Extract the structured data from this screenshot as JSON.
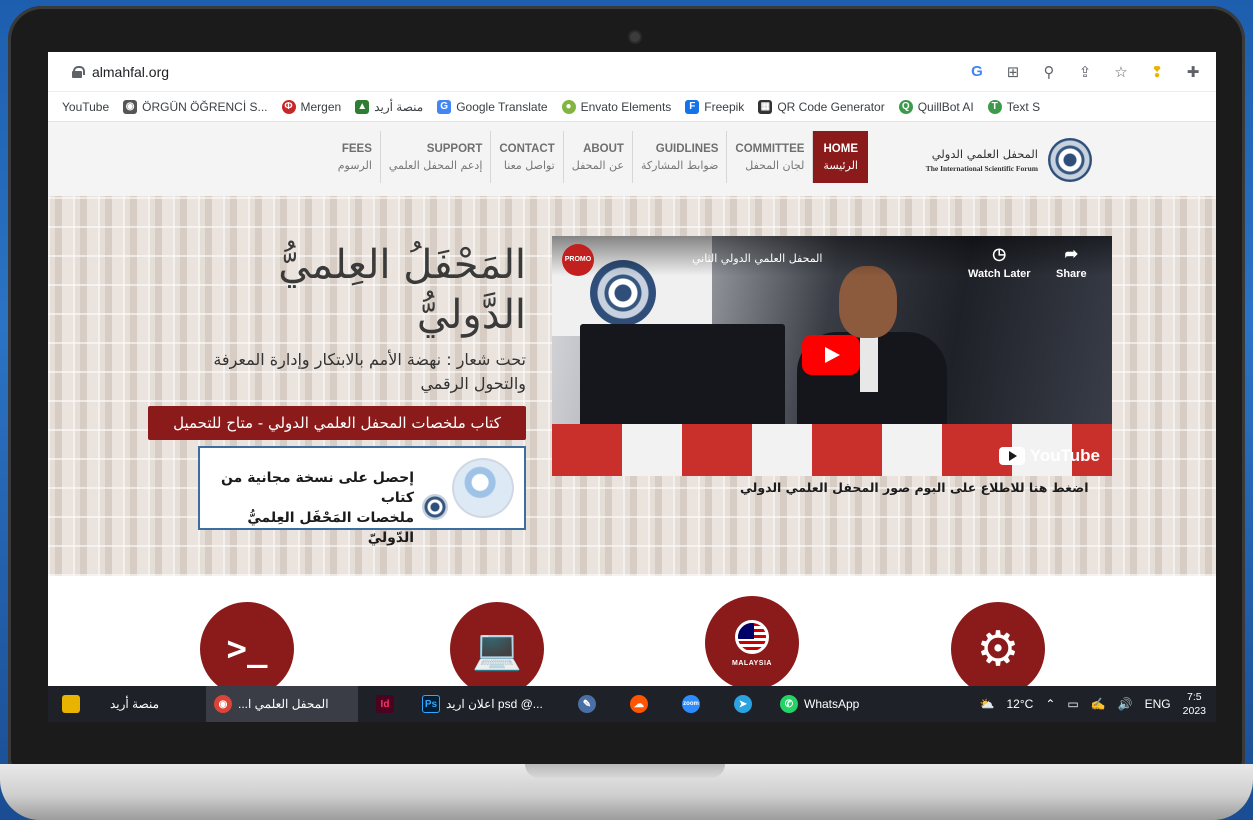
{
  "browser": {
    "url": "almahfal.org",
    "icons": [
      "google-lens-icon",
      "translate-icon",
      "zoom-icon",
      "share-icon",
      "bookmark-star-icon",
      "bulb-icon",
      "extensions-icon"
    ]
  },
  "bookmarks": [
    {
      "label": "YouTube",
      "icon": "youtube"
    },
    {
      "label": "ÖRGÜN ÖĞRENCİ S...",
      "icon": "orgun"
    },
    {
      "label": "Mergen",
      "icon": "mergen"
    },
    {
      "label": "منصة أريد",
      "icon": "arid"
    },
    {
      "label": "Google Translate",
      "icon": "translate"
    },
    {
      "label": "Envato Elements",
      "icon": "envato"
    },
    {
      "label": "Freepik",
      "icon": "freepik"
    },
    {
      "label": "QR Code Generator",
      "icon": "qr"
    },
    {
      "label": "QuillBot AI",
      "icon": "quillbot"
    },
    {
      "label": "Text S",
      "icon": "text"
    }
  ],
  "site": {
    "logo_ar": "المحفل العلمي الدولي",
    "logo_en": "The International Scientific Forum",
    "nav": [
      {
        "en": "HOME",
        "ar": "الرئيسة",
        "active": true
      },
      {
        "en": "COMMITTEE",
        "ar": "لجان المحفل"
      },
      {
        "en": "GUIDLINES",
        "ar": "ضوابط المشاركة"
      },
      {
        "en": "ABOUT",
        "ar": "عن المحفل"
      },
      {
        "en": "CONTACT",
        "ar": "تواصل معنا"
      },
      {
        "en": "SUPPORT",
        "ar": "إدعم المحفل العلمي"
      },
      {
        "en": "FEES",
        "ar": "الرسوم"
      }
    ]
  },
  "hero": {
    "title_line1": "المَحْفَلُ العِلميُّ",
    "title_line2": "الدَّوليُّ",
    "subtitle_line1": "تحت شعار : نهضة الأمم بالابتكار وإدارة المعرفة",
    "subtitle_line2": "والتحول الرقمي",
    "download_button": "كتاب ملخصات المحفل العلمي الدولي - متاح للتحميل",
    "book_text_line1": "إحصل على نسخة مجانية من كتاب",
    "book_text_line2": "ملخصات المَحْفَل العِلميُّ الدّوليّ",
    "album_link": "اضغط هنا للاطلاع على البوم صور المحفل العلمي الدولي"
  },
  "video": {
    "channel_badge": "PROMO",
    "title": "المحفل العلمي الدولي الثاني",
    "watch_later": "Watch Later",
    "share": "Share",
    "brand": "YouTube"
  },
  "features": [
    {
      "icon": "terminal-icon"
    },
    {
      "icon": "laptop-icon"
    },
    {
      "icon": "map-pin-icon",
      "label": "MALAYSIA"
    },
    {
      "icon": "gear-icon"
    }
  ],
  "taskbar": {
    "items": [
      {
        "label": "منصة أريد",
        "icon": "folder"
      },
      {
        "label": "...المحفل العلمي ا",
        "icon": "chrome",
        "active": true
      },
      {
        "label": "",
        "icon": "indesign",
        "text": "Id"
      },
      {
        "label": "اعلان اريد psd @...",
        "icon": "photoshop",
        "text": "Ps"
      },
      {
        "label": "",
        "icon": "paint"
      },
      {
        "label": "",
        "icon": "soundcloud"
      },
      {
        "label": "",
        "icon": "zoom"
      },
      {
        "label": "",
        "icon": "telegram"
      },
      {
        "label": "WhatsApp",
        "icon": "whatsapp"
      }
    ],
    "weather": "12°C",
    "language": "ENG",
    "time": "7:5",
    "year": "2023"
  },
  "colors": {
    "brand": "#8b1a1a",
    "taskbar": "#1f2128"
  }
}
